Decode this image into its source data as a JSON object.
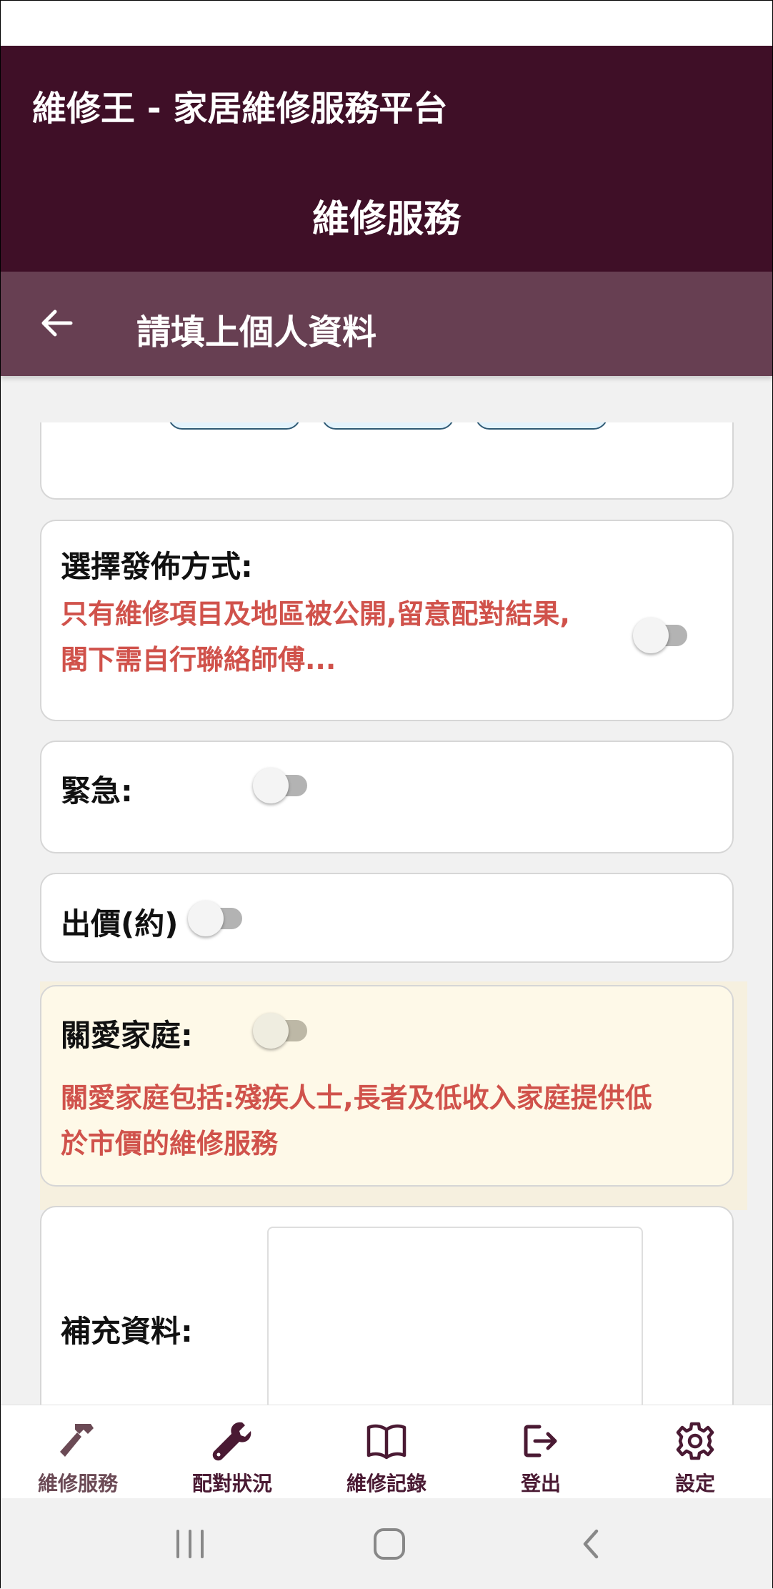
{
  "app": {
    "title": "維修王 - 家居維修服務平台",
    "page_title": "維修服務"
  },
  "sub_header": {
    "title": "請填上個人資料"
  },
  "publish": {
    "label": "選擇發佈方式:",
    "description_line1": "只有維修項目及地區被公開,留意配對結果,",
    "description_line2": "閣下需自行聯絡師傅..."
  },
  "urgent": {
    "label": "緊急:"
  },
  "quote": {
    "label": "出價(約)"
  },
  "caring_family": {
    "label": "關愛家庭:",
    "description_line1": "關愛家庭包括:殘疾人士,長者及低收入家庭提供低",
    "description_line2": "於市價的維修服務"
  },
  "supplementary": {
    "label": "補充資料:"
  },
  "toggles": {
    "publish": false,
    "urgent": false,
    "quote": false,
    "caring_family": false
  },
  "bottom_nav": {
    "items": [
      {
        "label": "維修服務",
        "icon": "hammer-icon",
        "active": true
      },
      {
        "label": "配對狀況",
        "icon": "wrench-icon",
        "active": false
      },
      {
        "label": "維修記錄",
        "icon": "book-icon",
        "active": false
      },
      {
        "label": "登出",
        "icon": "logout-icon",
        "active": false
      },
      {
        "label": "設定",
        "icon": "gear-icon",
        "active": false
      }
    ]
  },
  "colors": {
    "app_bar": "#3f0f27",
    "sub_header": "#673f52",
    "warning_text": "#d0524b",
    "caring_background": "#fef9e8"
  }
}
